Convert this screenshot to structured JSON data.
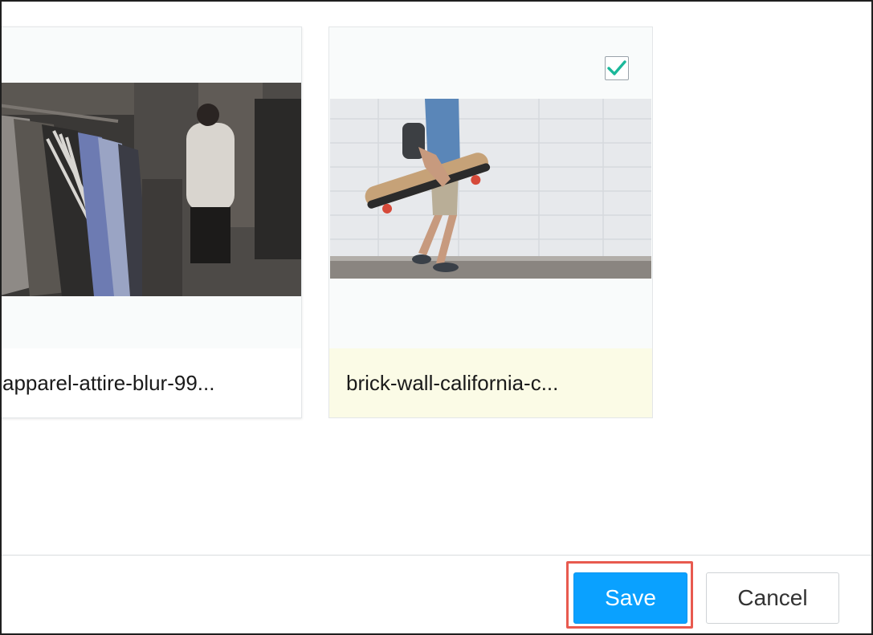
{
  "images": [
    {
      "caption": "apparel-attire-blur-99...",
      "selected": false,
      "thumbnail_icon": "clothing-rack-photo"
    },
    {
      "caption": "brick-wall-california-c...",
      "selected": true,
      "thumbnail_icon": "skateboarder-photo"
    }
  ],
  "footer": {
    "save_label": "Save",
    "cancel_label": "Cancel"
  },
  "colors": {
    "primary": "#0aa1ff",
    "highlight": "#e85a4f",
    "selected_caption_bg": "#fbfbe6",
    "check": "#1bb89a"
  }
}
